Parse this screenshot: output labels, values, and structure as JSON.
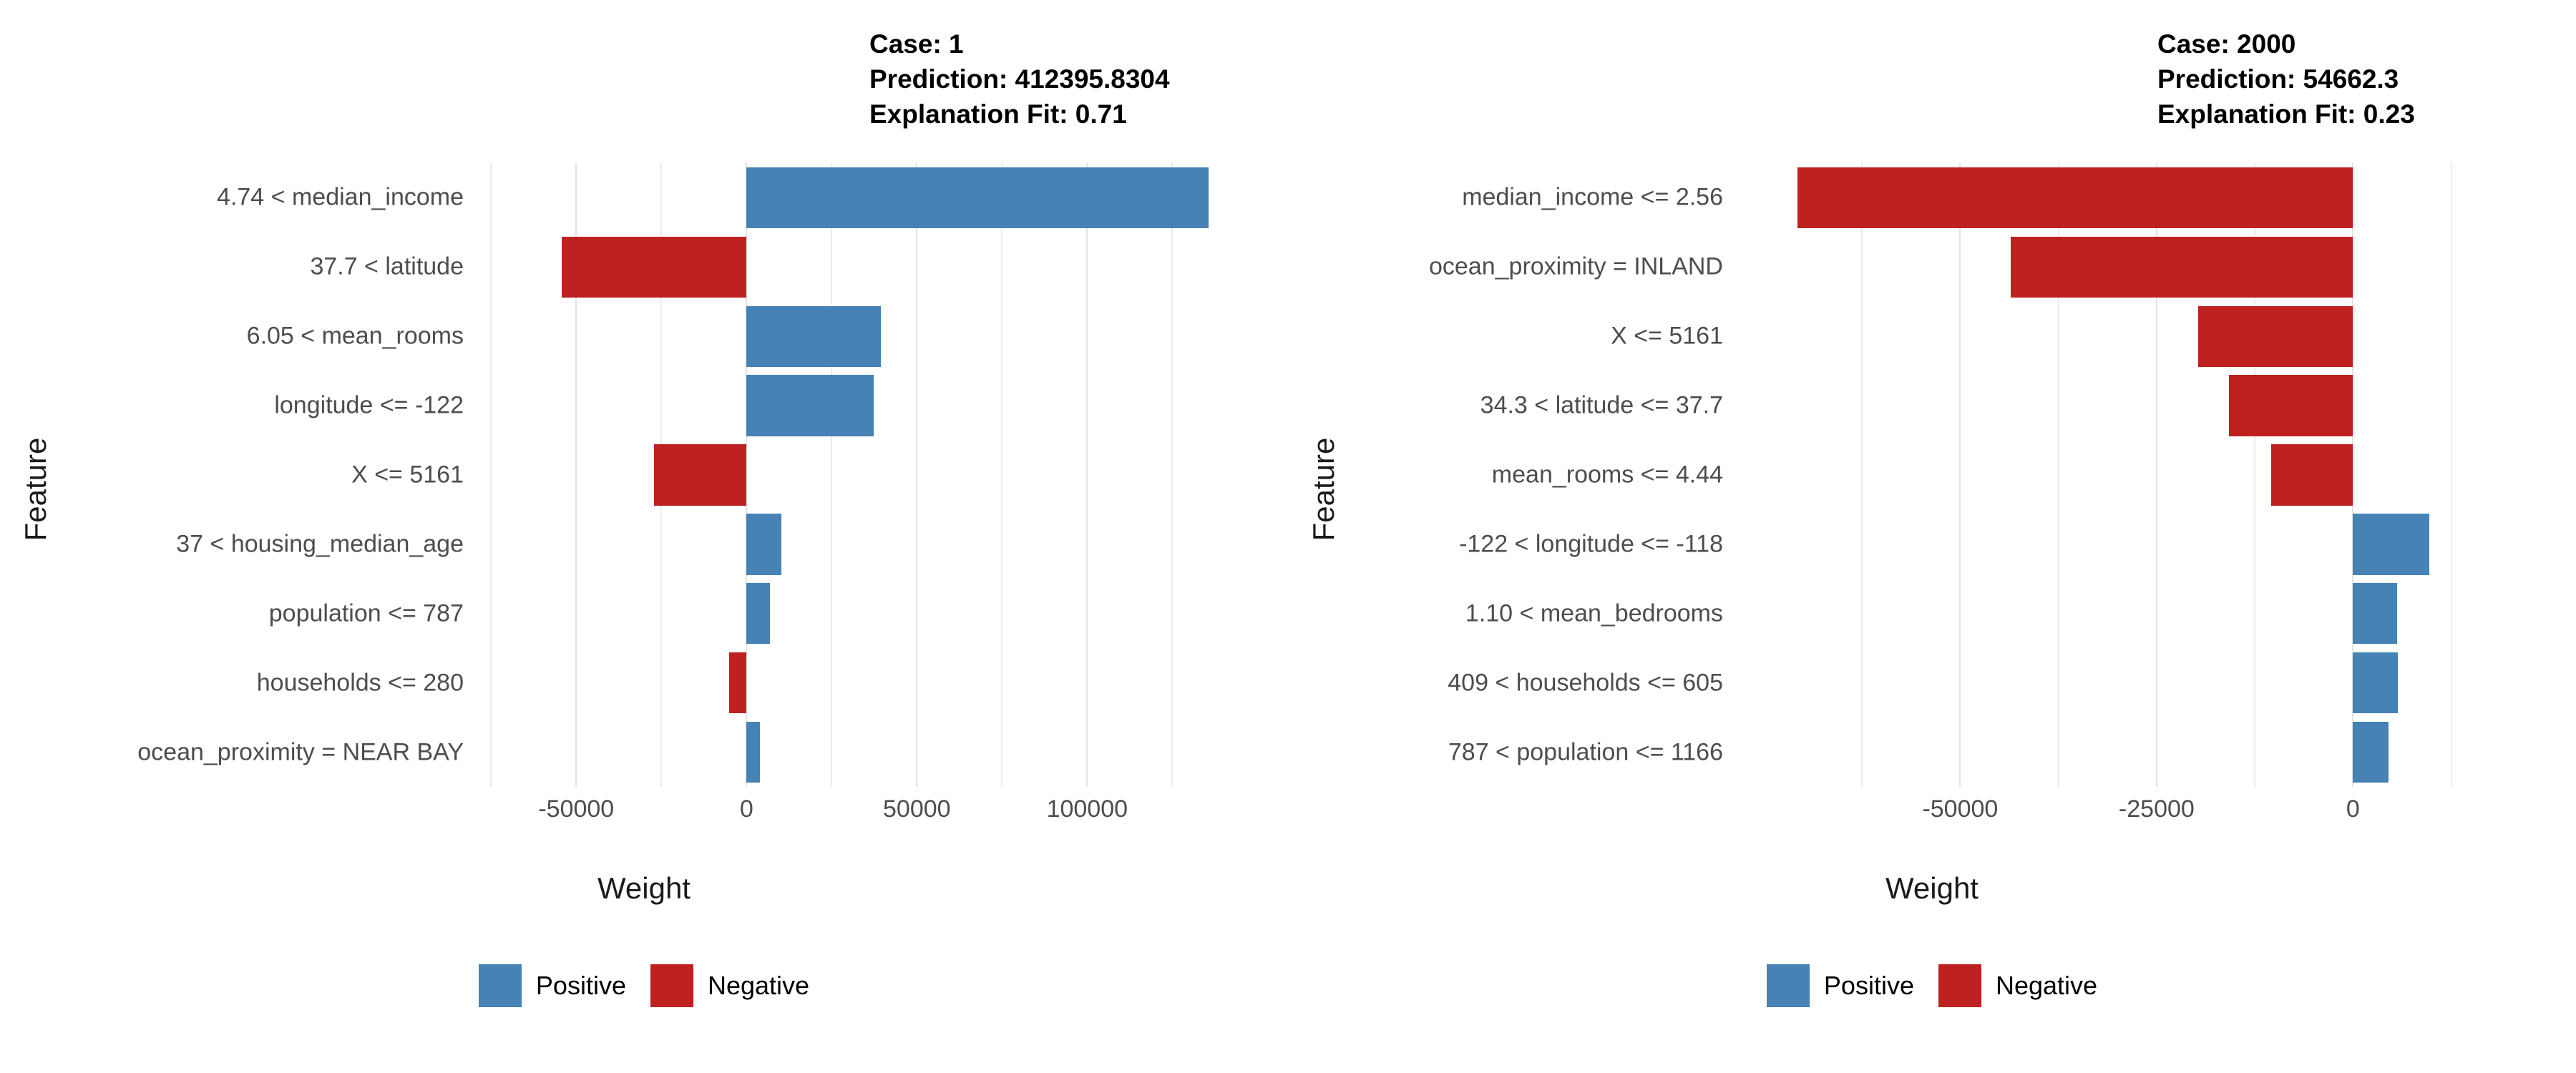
{
  "chart_data": [
    {
      "type": "bar",
      "orientation": "horizontal",
      "panel": "left",
      "title": "Case: 1",
      "title_lines": [
        "Case: 1",
        "Prediction: 412395.8304",
        "Explanation Fit: 0.71"
      ],
      "case": "1",
      "prediction": "412395.8304",
      "explanation_fit": "0.71",
      "xlabel": "Weight",
      "ylabel": "Feature",
      "xlim": [
        -78000,
        143000
      ],
      "xticks": [
        -50000,
        0,
        50000,
        100000
      ],
      "xticklabels": [
        "-50000",
        "0",
        "50000",
        "100000"
      ],
      "gridlines_minor": [
        -75000,
        -25000,
        25000,
        75000,
        125000
      ],
      "grid": true,
      "legend": {
        "position": "bottom",
        "entries": [
          {
            "label": "Positive",
            "color": "#4682B4"
          },
          {
            "label": "Negative",
            "color": "#BE2220"
          }
        ]
      },
      "categories": [
        "4.74 < median_income",
        "37.7 < latitude",
        "6.05 < mean_rooms",
        "longitude <= -122",
        "X <= 5161",
        "37 < housing_median_age",
        "population <= 787",
        "households <= 280",
        "ocean_proximity = NEAR BAY"
      ],
      "values": [
        135700,
        -54200,
        39500,
        37300,
        -27200,
        10300,
        6900,
        -5100,
        4000
      ],
      "signs": [
        "Positive",
        "Negative",
        "Positive",
        "Positive",
        "Negative",
        "Positive",
        "Positive",
        "Negative",
        "Positive"
      ]
    },
    {
      "type": "bar",
      "orientation": "horizontal",
      "panel": "right",
      "title": "Case: 2000",
      "title_lines": [
        "Case: 2000",
        "Prediction: 54662.3",
        "Explanation Fit: 0.23"
      ],
      "case": "2000",
      "prediction": "54662.3",
      "explanation_fit": "0.23",
      "xlabel": "Weight",
      "ylabel": "Feature",
      "xlim": [
        -78000,
        16000
      ],
      "xticks": [
        -50000,
        -25000,
        0
      ],
      "xticklabels": [
        "-50000",
        "-25000",
        "0"
      ],
      "gridlines_minor": [
        -62500,
        -37500,
        -12500,
        12500
      ],
      "grid": true,
      "legend": {
        "position": "bottom",
        "entries": [
          {
            "label": "Positive",
            "color": "#4682B4"
          },
          {
            "label": "Negative",
            "color": "#BE2220"
          }
        ]
      },
      "categories": [
        "median_income <= 2.56",
        "ocean_proximity = INLAND",
        "X <= 5161",
        "34.3 < latitude <= 37.7",
        "mean_rooms <= 4.44",
        "-122 < longitude <= -118",
        "1.10 < mean_bedrooms",
        "409 < households <= 605",
        "787 < population <= 1166"
      ],
      "values": [
        -70700,
        -43600,
        -19700,
        -15800,
        -10450,
        9700,
        5600,
        5700,
        4550
      ],
      "signs": [
        "Negative",
        "Negative",
        "Negative",
        "Negative",
        "Negative",
        "Positive",
        "Positive",
        "Positive",
        "Positive"
      ]
    }
  ],
  "colors": {
    "positive": "#4682B4",
    "negative": "#BE2220",
    "grid": "#ebebeb",
    "background": "#ffffff",
    "tick_text": "#4d4d4d",
    "axis_title": "#1a1a1a",
    "facet_title": "#000000"
  },
  "panels": [
    {
      "title_lines": [
        "Case: 1",
        "Prediction: 412395.8304",
        "Explanation Fit: 0.71"
      ],
      "axis_x_title": "Weight",
      "axis_y_title": "Feature",
      "legend_labels": [
        "Positive",
        "Negative"
      ]
    },
    {
      "title_lines": [
        "Case: 2000",
        "Prediction: 54662.3",
        "Explanation Fit: 0.23"
      ],
      "axis_x_title": "Weight",
      "axis_y_title": "Feature",
      "legend_labels": [
        "Positive",
        "Negative"
      ]
    }
  ]
}
